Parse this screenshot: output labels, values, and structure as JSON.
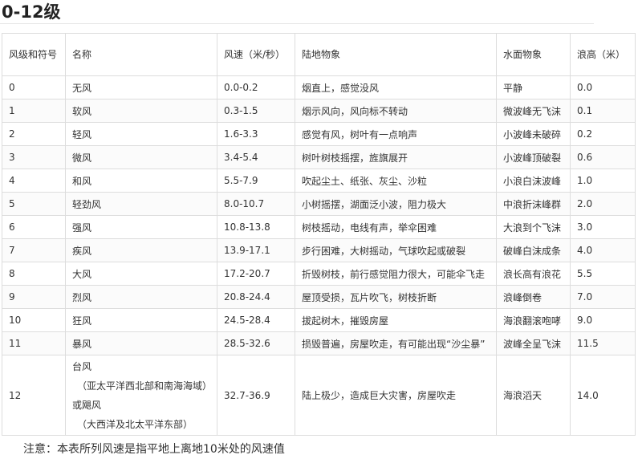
{
  "title": "0-12级",
  "table": {
    "headers": [
      "风级和符号",
      "名称",
      "风速（米/秒）",
      "陆地物象",
      "水面物象",
      "浪高（米）"
    ],
    "rows": [
      [
        "0",
        "无风",
        "0.0-0.2",
        "烟直上，感觉没风",
        "平静",
        "0.0"
      ],
      [
        "1",
        "软风",
        "0.3-1.5",
        "烟示风向，风向标不转动",
        "微波峰无飞沫",
        "0.1"
      ],
      [
        "2",
        "轻风",
        "1.6-3.3",
        "感觉有风，树叶有一点响声",
        "小波峰未破碎",
        "0.2"
      ],
      [
        "3",
        "微风",
        "3.4-5.4",
        "树叶树枝摇摆，旌旗展开",
        "小波峰顶破裂",
        "0.6"
      ],
      [
        "4",
        "和风",
        "5.5-7.9",
        "吹起尘土、纸张、灰尘、沙粒",
        "小浪白沫波峰",
        "1.0"
      ],
      [
        "5",
        "轻劲风",
        "8.0-10.7",
        "小树摇摆，湖面泛小波，阻力极大",
        "中浪折沫峰群",
        "2.0"
      ],
      [
        "6",
        "强风",
        "10.8-13.8",
        "树枝摇动，电线有声，举伞困难",
        "大浪到个飞沫",
        "3.0"
      ],
      [
        "7",
        "疾风",
        "13.9-17.1",
        "步行困难，大树摇动，气球吹起或破裂",
        "破峰白沫成条",
        "4.0"
      ],
      [
        "8",
        "大风",
        "17.2-20.7",
        "折毁树枝，前行感觉阻力很大，可能伞飞走",
        "浪长高有浪花",
        "5.5"
      ],
      [
        "9",
        "烈风",
        "20.8-24.4",
        "屋顶受损，瓦片吹飞，树枝折断",
        "浪峰倒卷",
        "7.0"
      ],
      [
        "10",
        "狂风",
        "24.5-28.4",
        "拔起树木，摧毁房屋",
        "海浪翻滚咆哮",
        "9.0"
      ],
      [
        "11",
        "暴风",
        "28.5-32.6",
        "损毁普遍，房屋吹走，有可能出现“沙尘暴”",
        "波峰全呈飞沫",
        "11.5"
      ]
    ],
    "last_row": {
      "grade": "12",
      "name_line1": "台风",
      "name_line2": "（亚太平洋西北部和南海海域）",
      "name_line3": "或飓风",
      "name_line4": "（大西洋及北太平洋东部）",
      "speed": "32.7-36.9",
      "land": "陆上极少，造成巨大灾害，房屋吹走",
      "water": "海浪滔天",
      "wave": "14.0"
    }
  },
  "note": "注意：本表所列风速是指平地上离地10米处的风速值"
}
